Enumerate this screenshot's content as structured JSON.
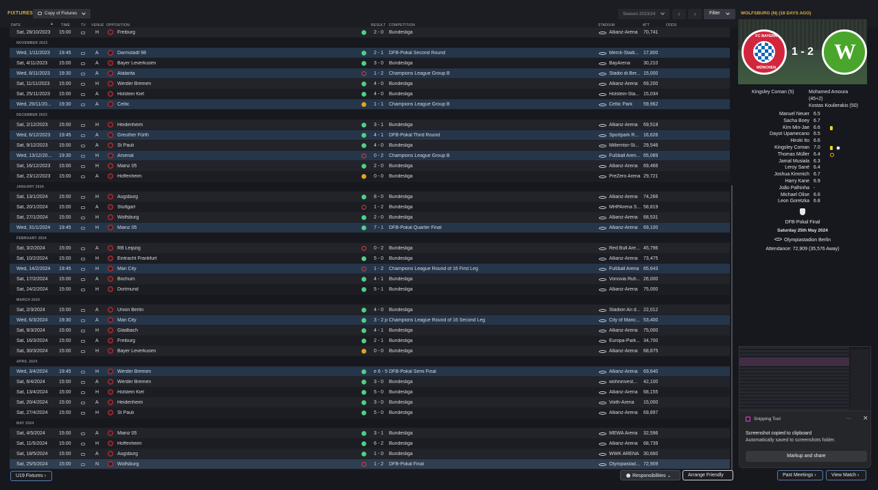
{
  "header": {
    "title": "FIXTURES",
    "view_label": "Copy of Fixtures",
    "season_label": "Season 2023/24",
    "filter_label": "Filter",
    "right_title": "WOLFSBURG (N) (18 DAYS AGO)"
  },
  "columns": {
    "date": "DATE",
    "time": "TIME",
    "tv": "TV",
    "venue": "VENUE",
    "opposition": "OPPOSITION",
    "result": "RESULT",
    "competition": "COMPETITION",
    "stadium": "STADIUM",
    "att": "ATT",
    "odds": "ODDS"
  },
  "rows": [
    {
      "type": "fx",
      "bg": "odd",
      "date": "Sat, 28/10/2023",
      "time": "15:00",
      "venue": "H",
      "opp": "Freiburg",
      "o": "w",
      "res": "2 - 0",
      "comp": "Bundesliga",
      "stad": "Allianz-Arena",
      "att": "70,741"
    },
    {
      "type": "month",
      "label": "NOVEMBER 2023"
    },
    {
      "type": "fx",
      "bg": "cup",
      "date": "Wed, 1/11/2023",
      "time": "19:45",
      "venue": "A",
      "opp": "Darmstadt 98",
      "o": "w",
      "res": "2 - 1",
      "comp": "DFB-Pokal Second Round",
      "stad": "Merck-Stadi...",
      "att": "17,800"
    },
    {
      "type": "fx",
      "bg": "even",
      "date": "Sat, 4/11/2023",
      "time": "15:00",
      "venue": "A",
      "opp": "Bayer Leverkusen",
      "o": "w",
      "res": "3 - 0",
      "comp": "Bundesliga",
      "stad": "BayArena",
      "att": "30,210"
    },
    {
      "type": "fx",
      "bg": "cup",
      "date": "Wed, 8/11/2023",
      "time": "19:30",
      "venue": "A",
      "opp": "Atalanta",
      "o": "l",
      "res": "1 - 2",
      "comp": "Champions League Group B",
      "stad": "Stadio di Ber...",
      "att": "15,000"
    },
    {
      "type": "fx",
      "bg": "odd",
      "date": "Sat, 11/11/2023",
      "time": "15:00",
      "venue": "H",
      "opp": "Werder Bremen",
      "o": "w",
      "res": "4 - 0",
      "comp": "Bundesliga",
      "stad": "Allianz-Arena",
      "att": "69,200"
    },
    {
      "type": "fx",
      "bg": "even",
      "date": "Sat, 25/11/2023",
      "time": "15:00",
      "venue": "A",
      "opp": "Holstein Kiel",
      "o": "w",
      "res": "4 - 0",
      "comp": "Bundesliga",
      "stad": "Holstein-Sta...",
      "att": "15,034"
    },
    {
      "type": "fx",
      "bg": "cup",
      "date": "Wed, 29/11/20...",
      "time": "19:30",
      "venue": "A",
      "opp": "Celtic",
      "o": "d",
      "res": "1 - 1",
      "comp": "Champions League Group B",
      "stad": "Celtic Park",
      "att": "59,962"
    },
    {
      "type": "month",
      "label": "DECEMBER 2023"
    },
    {
      "type": "fx",
      "bg": "odd",
      "date": "Sat, 2/12/2023",
      "time": "15:00",
      "venue": "H",
      "opp": "Heidenheim",
      "o": "w",
      "res": "3 - 1",
      "comp": "Bundesliga",
      "stad": "Allianz-Arena",
      "att": "69,518"
    },
    {
      "type": "fx",
      "bg": "cup",
      "date": "Wed, 6/12/2023",
      "time": "19:45",
      "venue": "A",
      "opp": "Greuther Fürth",
      "o": "w",
      "res": "4 - 1",
      "comp": "DFB-Pokal Third Round",
      "stad": "Sportpark R...",
      "att": "16,626"
    },
    {
      "type": "fx",
      "bg": "odd",
      "date": "Sat, 9/12/2023",
      "time": "15:00",
      "venue": "A",
      "opp": "St Pauli",
      "o": "w",
      "res": "4 - 0",
      "comp": "Bundesliga",
      "stad": "Millerntor-St...",
      "att": "29,546"
    },
    {
      "type": "fx",
      "bg": "cup",
      "date": "Wed, 13/12/20...",
      "time": "19:30",
      "venue": "H",
      "opp": "Arsenal",
      "o": "l",
      "res": "0 - 2",
      "comp": "Champions League Group B",
      "stad": "Fußball Aren...",
      "att": "65,089"
    },
    {
      "type": "fx",
      "bg": "odd",
      "date": "Sat, 16/12/2023",
      "time": "15:00",
      "venue": "H",
      "opp": "Mainz 05",
      "o": "w",
      "res": "2 - 0",
      "comp": "Bundesliga",
      "stad": "Allianz-Arena",
      "att": "69,466"
    },
    {
      "type": "fx",
      "bg": "even",
      "date": "Sat, 23/12/2023",
      "time": "15:00",
      "venue": "A",
      "opp": "Hoffenheim",
      "o": "d",
      "res": "0 - 0",
      "comp": "Bundesliga",
      "stad": "PreZero Arena",
      "att": "29,721"
    },
    {
      "type": "month",
      "label": "JANUARY 2024"
    },
    {
      "type": "fx",
      "bg": "odd",
      "date": "Sat, 13/1/2024",
      "time": "15:00",
      "venue": "H",
      "opp": "Augsburg",
      "o": "w",
      "res": "8 - 0",
      "comp": "Bundesliga",
      "stad": "Allianz-Arena",
      "att": "74,266"
    },
    {
      "type": "fx",
      "bg": "even",
      "date": "Sat, 20/1/2024",
      "time": "15:00",
      "venue": "A",
      "opp": "Stuttgart",
      "o": "l",
      "res": "1 - 2",
      "comp": "Bundesliga",
      "stad": "MHPArena S...",
      "att": "58,819"
    },
    {
      "type": "fx",
      "bg": "odd",
      "date": "Sat, 27/1/2024",
      "time": "15:00",
      "venue": "H",
      "opp": "Wolfsburg",
      "o": "w",
      "res": "2 - 0",
      "comp": "Bundesliga",
      "stad": "Allianz-Arena",
      "att": "68,531"
    },
    {
      "type": "fx",
      "bg": "cup",
      "date": "Wed, 31/1/2024",
      "time": "19:45",
      "venue": "H",
      "opp": "Mainz 05",
      "o": "w",
      "res": "7 - 1",
      "comp": "DFB-Pokal Quarter Final",
      "stad": "Allianz-Arena",
      "att": "69,100"
    },
    {
      "type": "month",
      "label": "FEBRUARY 2024"
    },
    {
      "type": "fx",
      "bg": "odd",
      "date": "Sat, 3/2/2024",
      "time": "15:00",
      "venue": "A",
      "opp": "RB Leipzig",
      "o": "l",
      "res": "0 - 2",
      "comp": "Bundesliga",
      "stad": "Red Bull Are...",
      "att": "45,796"
    },
    {
      "type": "fx",
      "bg": "even",
      "date": "Sat, 10/2/2024",
      "time": "15:00",
      "venue": "H",
      "opp": "Eintracht Frankfurt",
      "o": "w",
      "res": "5 - 0",
      "comp": "Bundesliga",
      "stad": "Allianz-Arena",
      "att": "73,475"
    },
    {
      "type": "fx",
      "bg": "cup",
      "date": "Wed, 14/2/2024",
      "time": "19:45",
      "venue": "H",
      "opp": "Man City",
      "o": "l",
      "res": "1 - 2",
      "comp": "Champions League Round of 16  First Leg",
      "stad": "Fußball Arena",
      "att": "65,643"
    },
    {
      "type": "fx",
      "bg": "odd",
      "date": "Sat, 17/2/2024",
      "time": "15:00",
      "venue": "A",
      "opp": "Bochum",
      "o": "w",
      "res": "4 - 1",
      "comp": "Bundesliga",
      "stad": "Vonovia Ruh...",
      "att": "26,000"
    },
    {
      "type": "fx",
      "bg": "even",
      "date": "Sat, 24/2/2024",
      "time": "15:00",
      "venue": "H",
      "opp": "Dortmund",
      "o": "w",
      "res": "5 - 1",
      "comp": "Bundesliga",
      "stad": "Allianz-Arena",
      "att": "75,000"
    },
    {
      "type": "month",
      "label": "MARCH 2024"
    },
    {
      "type": "fx",
      "bg": "odd",
      "date": "Sat, 2/3/2024",
      "time": "15:00",
      "venue": "A",
      "opp": "Union Berlin",
      "o": "w",
      "res": "4 - 0",
      "comp": "Bundesliga",
      "stad": "Stadion An d...",
      "att": "22,012"
    },
    {
      "type": "fx",
      "bg": "cup",
      "date": "Wed, 6/3/2024",
      "time": "19:30",
      "venue": "A",
      "opp": "Man City",
      "o": "w",
      "res": "3 - 2 p",
      "comp": "Champions League Round of 16  Second Leg",
      "stad": "City of Manc...",
      "att": "53,400"
    },
    {
      "type": "fx",
      "bg": "odd",
      "date": "Sat, 9/3/2024",
      "time": "15:00",
      "venue": "H",
      "opp": "Gladbach",
      "o": "w",
      "res": "4 - 1",
      "comp": "Bundesliga",
      "stad": "Allianz-Arena",
      "att": "75,000"
    },
    {
      "type": "fx",
      "bg": "even",
      "date": "Sat, 16/3/2024",
      "time": "15:00",
      "venue": "A",
      "opp": "Freiburg",
      "o": "w",
      "res": "2 - 1",
      "comp": "Bundesliga",
      "stad": "Europa-Park...",
      "att": "34,700"
    },
    {
      "type": "fx",
      "bg": "odd",
      "date": "Sat, 30/3/2024",
      "time": "15:00",
      "venue": "H",
      "opp": "Bayer Leverkusen",
      "o": "d",
      "res": "0 - 0",
      "comp": "Bundesliga",
      "stad": "Allianz-Arena",
      "att": "68,875"
    },
    {
      "type": "month",
      "label": "APRIL 2024"
    },
    {
      "type": "fx",
      "bg": "cup",
      "date": "Wed, 3/4/2024",
      "time": "19:45",
      "venue": "H",
      "opp": "Werder Bremen",
      "o": "w",
      "res": "e 6 - 5",
      "comp": "DFB-Pokal Semi Final",
      "stad": "Allianz-Arena",
      "att": "69,640"
    },
    {
      "type": "fx",
      "bg": "odd",
      "date": "Sat, 6/4/2024",
      "time": "15:00",
      "venue": "A",
      "opp": "Werder Bremen",
      "o": "w",
      "res": "3 - 0",
      "comp": "Bundesliga",
      "stad": "wohninvest...",
      "att": "42,100"
    },
    {
      "type": "fx",
      "bg": "even",
      "date": "Sat, 13/4/2024",
      "time": "15:00",
      "venue": "H",
      "opp": "Holstein Kiel",
      "o": "w",
      "res": "5 - 0",
      "comp": "Bundesliga",
      "stad": "Allianz-Arena",
      "att": "68,155"
    },
    {
      "type": "fx",
      "bg": "odd",
      "date": "Sat, 20/4/2024",
      "time": "15:00",
      "venue": "A",
      "opp": "Heidenheim",
      "o": "w",
      "res": "3 - 0",
      "comp": "Bundesliga",
      "stad": "Voith-Arena",
      "att": "15,000"
    },
    {
      "type": "fx",
      "bg": "even",
      "date": "Sat, 27/4/2024",
      "time": "15:00",
      "venue": "H",
      "opp": "St Pauli",
      "o": "w",
      "res": "5 - 0",
      "comp": "Bundesliga",
      "stad": "Allianz-Arena",
      "att": "69,897"
    },
    {
      "type": "month",
      "label": "MAY 2024"
    },
    {
      "type": "fx",
      "bg": "odd",
      "date": "Sat, 4/5/2024",
      "time": "15:00",
      "venue": "A",
      "opp": "Mainz 05",
      "o": "w",
      "res": "3 - 1",
      "comp": "Bundesliga",
      "stad": "MEWA Arena",
      "att": "32,596"
    },
    {
      "type": "fx",
      "bg": "even",
      "date": "Sat, 11/5/2024",
      "time": "15:00",
      "venue": "H",
      "opp": "Hoffenheim",
      "o": "w",
      "res": "6 - 2",
      "comp": "Bundesliga",
      "stad": "Allianz-Arena",
      "att": "68,739"
    },
    {
      "type": "fx",
      "bg": "odd",
      "date": "Sat, 18/5/2024",
      "time": "15:00",
      "venue": "A",
      "opp": "Augsburg",
      "o": "w",
      "res": "1 - 0",
      "comp": "Bundesliga",
      "stad": "WWK ARENA",
      "att": "30,660"
    },
    {
      "type": "fx",
      "bg": "sel",
      "date": "Sat, 25/5/2024",
      "time": "15:00",
      "venue": "N",
      "opp": "Wolfsburg",
      "o": "l",
      "res": "1 - 2",
      "comp": "DFB-Pokal Final",
      "stad": "Olympiastad...",
      "att": "72,909"
    }
  ],
  "match": {
    "home_logo_top": "FC BAYERN",
    "home_logo_bottom": "MÜNCHEN",
    "away_logo": "W",
    "score": "1 - 2",
    "home_scorers": [
      "Kingsley Coman (5)"
    ],
    "away_scorers": [
      "Mohamed Amoura",
      "(45+2)",
      "Kostas Koulierakis (50)"
    ],
    "lineup": [
      {
        "name": "Manuel Neuer",
        "rating": "6.5"
      },
      {
        "name": "Sacha Boey",
        "rating": "6.7"
      },
      {
        "name": "Kim Min-Jae",
        "rating": "6.6",
        "card": true
      },
      {
        "name": "Dayot Upamecano",
        "rating": "6.5"
      },
      {
        "name": "Hiroki Ito",
        "rating": "6.6"
      },
      {
        "name": "Kingsley Coman",
        "rating": "7.0",
        "card": true,
        "ball": true
      },
      {
        "name": "Thomas Müller",
        "rating": "6.4",
        "sub": true
      },
      {
        "name": "Jamal Musiala",
        "rating": "6.3"
      },
      {
        "name": "Leroy Sané",
        "rating": "6.4"
      },
      {
        "name": "Joshua Kimmich",
        "rating": "6.7"
      },
      {
        "name": "Harry Kane",
        "rating": "6.9"
      },
      {
        "name": "João Palhinha",
        "rating": "-"
      },
      {
        "name": "Michael Olise",
        "rating": "6.6"
      },
      {
        "name": "Leon Goretzka",
        "rating": "6.8"
      }
    ],
    "competition": "DFB-Pokal Final",
    "date": "Saturday 25th May 2024",
    "stadium": "Olympiastadion Berlin",
    "attendance": "Attendance: 72,909 (35,576 Away)"
  },
  "snip": {
    "app": "Snipping Tool",
    "title": "Screenshot copied to clipboard",
    "subtitle": "Automatically saved to screenshots folder.",
    "button": "Markup and share",
    "dots": "···",
    "close": "✕"
  },
  "footer": {
    "u19": "U19 Fixtures",
    "responsibilities": "Responsibilities",
    "arrange": "Arrange Friendly",
    "past": "Past Meetings",
    "view": "View Match"
  }
}
